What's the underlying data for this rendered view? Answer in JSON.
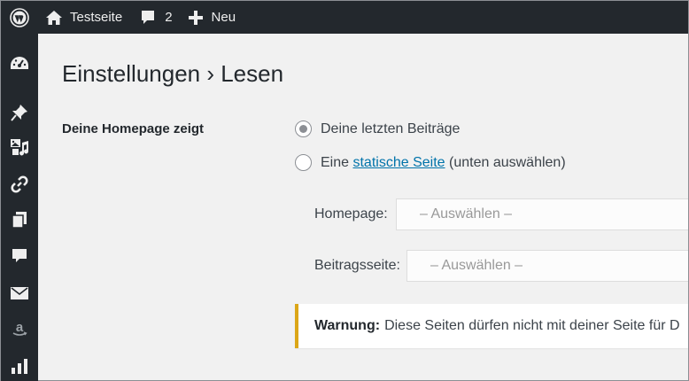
{
  "adminbar": {
    "site_name": "Testseite",
    "comment_count": "2",
    "new_label": "Neu",
    "icons": [
      "wordpress-logo-icon",
      "home-icon",
      "comment-icon",
      "plus-icon"
    ]
  },
  "sidebar": {
    "icons": [
      "dashboard-icon",
      "pin-icon",
      "media-icon",
      "link-icon",
      "pages-icon",
      "comments-icon",
      "mail-icon",
      "amazon-icon",
      "stats-icon"
    ]
  },
  "page": {
    "title": "Einstellungen › Lesen",
    "homepage_label": "Deine Homepage zeigt",
    "option_latest": "Deine letzten Beiträge",
    "option_static_prefix": "Eine",
    "option_static_link": "statische Seite",
    "option_static_suffix": "(unten auswählen)",
    "homepage_select_label": "Homepage:",
    "homepage_select_value": "– Auswählen –",
    "posts_select_label": "Beitragsseite:",
    "posts_select_value": "– Auswählen –",
    "warning_strong": "Warnung:",
    "warning_text": "Diese Seiten dürfen nicht mit deiner Seite für D"
  },
  "colors": {
    "adminbar_bg": "#23282d",
    "content_bg": "#f1f1f1",
    "link": "#0073aa",
    "warning_border": "#dba617"
  }
}
